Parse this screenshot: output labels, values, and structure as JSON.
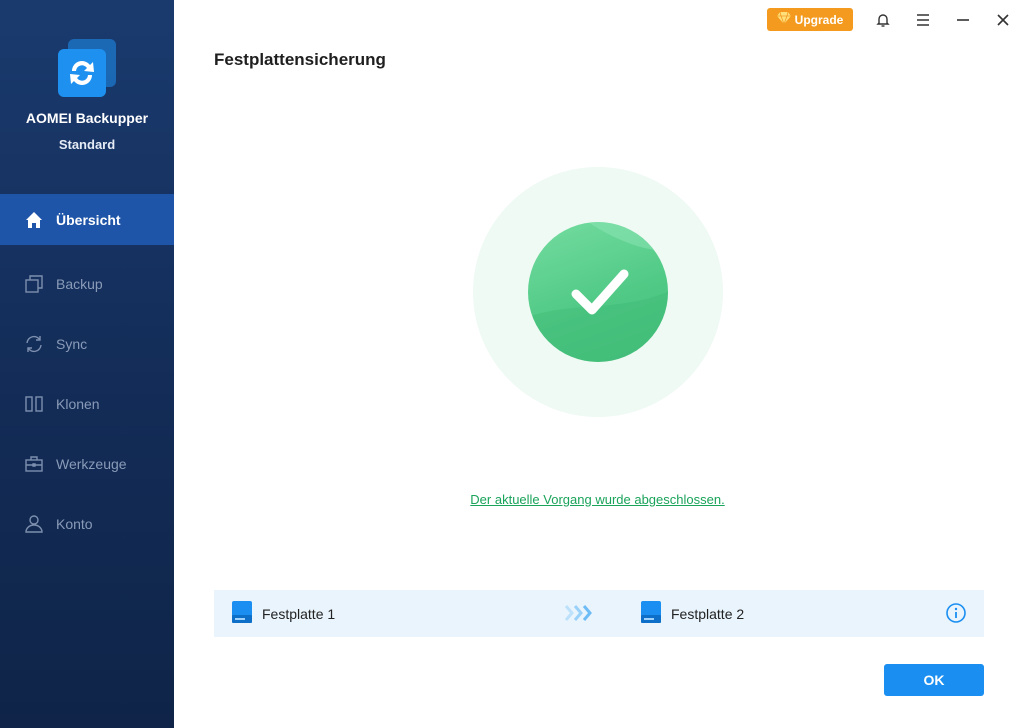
{
  "app": {
    "name": "AOMEI Backupper",
    "edition": "Standard"
  },
  "nav": [
    {
      "label": "Übersicht",
      "icon": "home-icon",
      "active": true
    },
    {
      "label": "Backup",
      "icon": "backup-icon",
      "active": false
    },
    {
      "label": "Sync",
      "icon": "sync-icon",
      "active": false
    },
    {
      "label": "Klonen",
      "icon": "clone-icon",
      "active": false
    },
    {
      "label": "Werkzeuge",
      "icon": "toolbox-icon",
      "active": false
    },
    {
      "label": "Konto",
      "icon": "user-icon",
      "active": false
    }
  ],
  "topbar": {
    "upgrade_label": "Upgrade"
  },
  "page": {
    "title": "Festplattensicherung",
    "status_text": "Der aktuelle Vorgang wurde abgeschlossen.",
    "source_disk": "Festplatte 1",
    "target_disk": "Festplatte 2",
    "ok_label": "OK"
  },
  "colors": {
    "sidebar": "#132c57",
    "nav_active": "#1f55a8",
    "upgrade": "#f39a1f",
    "success": "#4ec884",
    "link": "#1aa35a",
    "primary_button": "#1a8ff1"
  }
}
